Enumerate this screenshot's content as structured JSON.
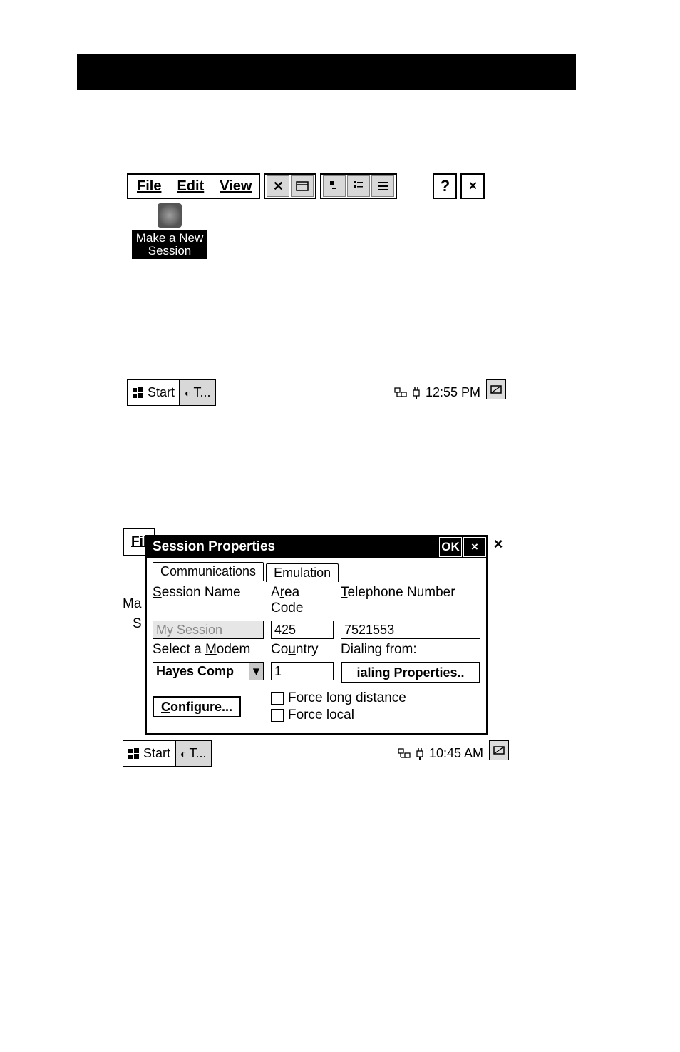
{
  "shot1": {
    "menubar": {
      "file": "File",
      "edit": "Edit",
      "view": "View"
    },
    "toolbar_icons": {
      "delete": "delete-icon",
      "properties": "properties-icon",
      "large_icons": "large-icons-icon",
      "small_icons": "small-icons-icon",
      "details": "details-icon"
    },
    "help_btn": "?",
    "close_btn": "×",
    "desktop_icon_label": "Make a New Session",
    "taskbar": {
      "start": "Start",
      "task1": "T...",
      "clock": "12:55 PM"
    }
  },
  "shot2": {
    "bg_menu": "Fil",
    "bg_mal": "Ma",
    "bg_s": "S",
    "dlg_title": "Session Properties",
    "ok_btn": "OK",
    "close_btn": "×",
    "outer_close": "×",
    "tabs": {
      "communications": "Communications",
      "emulation": "Emulation"
    },
    "labels": {
      "session_name": "Session Name",
      "area_code": "Area Code",
      "telephone_number": "Telephone Number",
      "select_modem": "Select a Modem",
      "country": "Country",
      "dialing_from": "Dialing from:"
    },
    "values": {
      "session_name": "My Session",
      "area_code": "425",
      "telephone_number": "7521553",
      "select_modem": "Hayes Comp",
      "country": "1"
    },
    "buttons": {
      "dialing_properties": "ialing Properties..",
      "configure": "Configure..."
    },
    "checks": {
      "force_long_distance": "Force long distance",
      "force_local": "Force local"
    },
    "taskbar": {
      "start": "Start",
      "task1": "T...",
      "clock": "10:45 AM"
    }
  }
}
